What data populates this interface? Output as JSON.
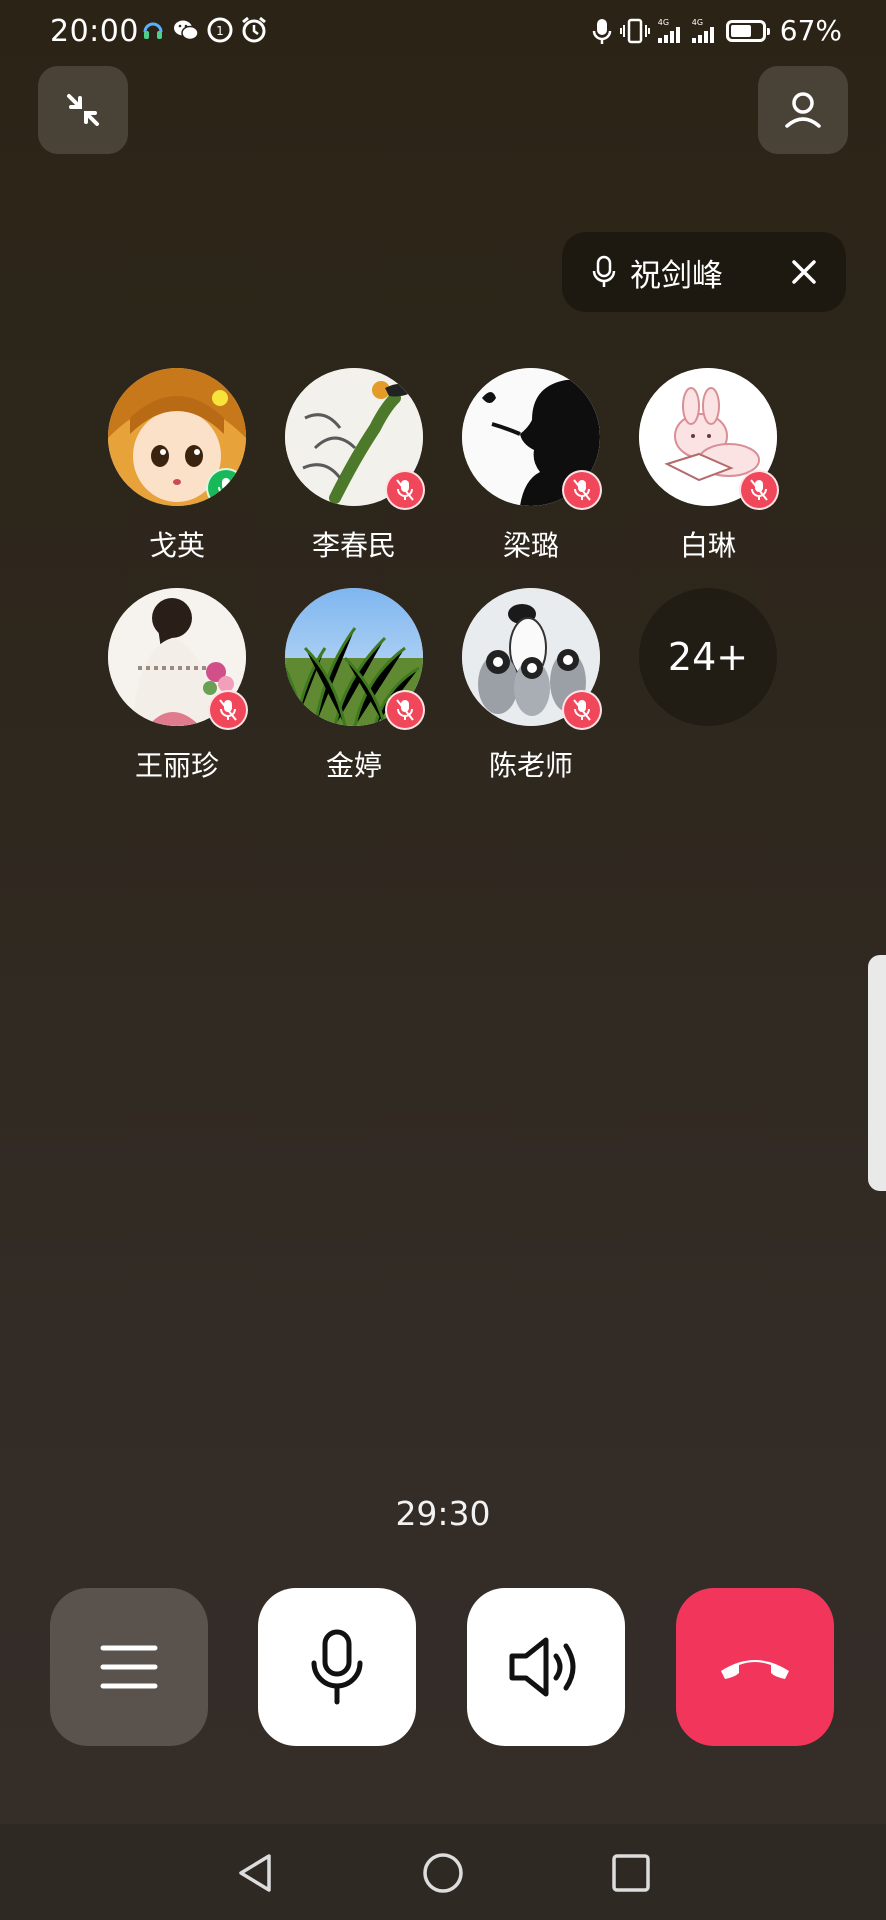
{
  "status_bar": {
    "time": "20:00",
    "network_1": "4G",
    "network_2": "4G",
    "battery_text": "67%",
    "battery_level": 0.67
  },
  "header": {
    "minimize_icon": "collapse-arrows-icon",
    "contacts_icon": "person-icon"
  },
  "speaking": {
    "name": "祝剑峰",
    "close_icon": "close-icon"
  },
  "members": [
    {
      "name": "戈英",
      "mic": "on"
    },
    {
      "name": "李春民",
      "mic": "off"
    },
    {
      "name": "梁璐",
      "mic": "off"
    },
    {
      "name": "白琳",
      "mic": "off"
    },
    {
      "name": "王丽珍",
      "mic": "off"
    },
    {
      "name": "金婷",
      "mic": "off"
    },
    {
      "name": "陈老师",
      "mic": "off"
    }
  ],
  "more_count": "24+",
  "timer": "29:30",
  "controls": {
    "menu": "menu-icon",
    "mic": "microphone-icon",
    "speaker": "speaker-icon",
    "hangup": "hang-up-icon"
  },
  "colors": {
    "mic_on": "#19b95a",
    "mic_off": "#f0475a",
    "hangup": "#f2365b"
  }
}
